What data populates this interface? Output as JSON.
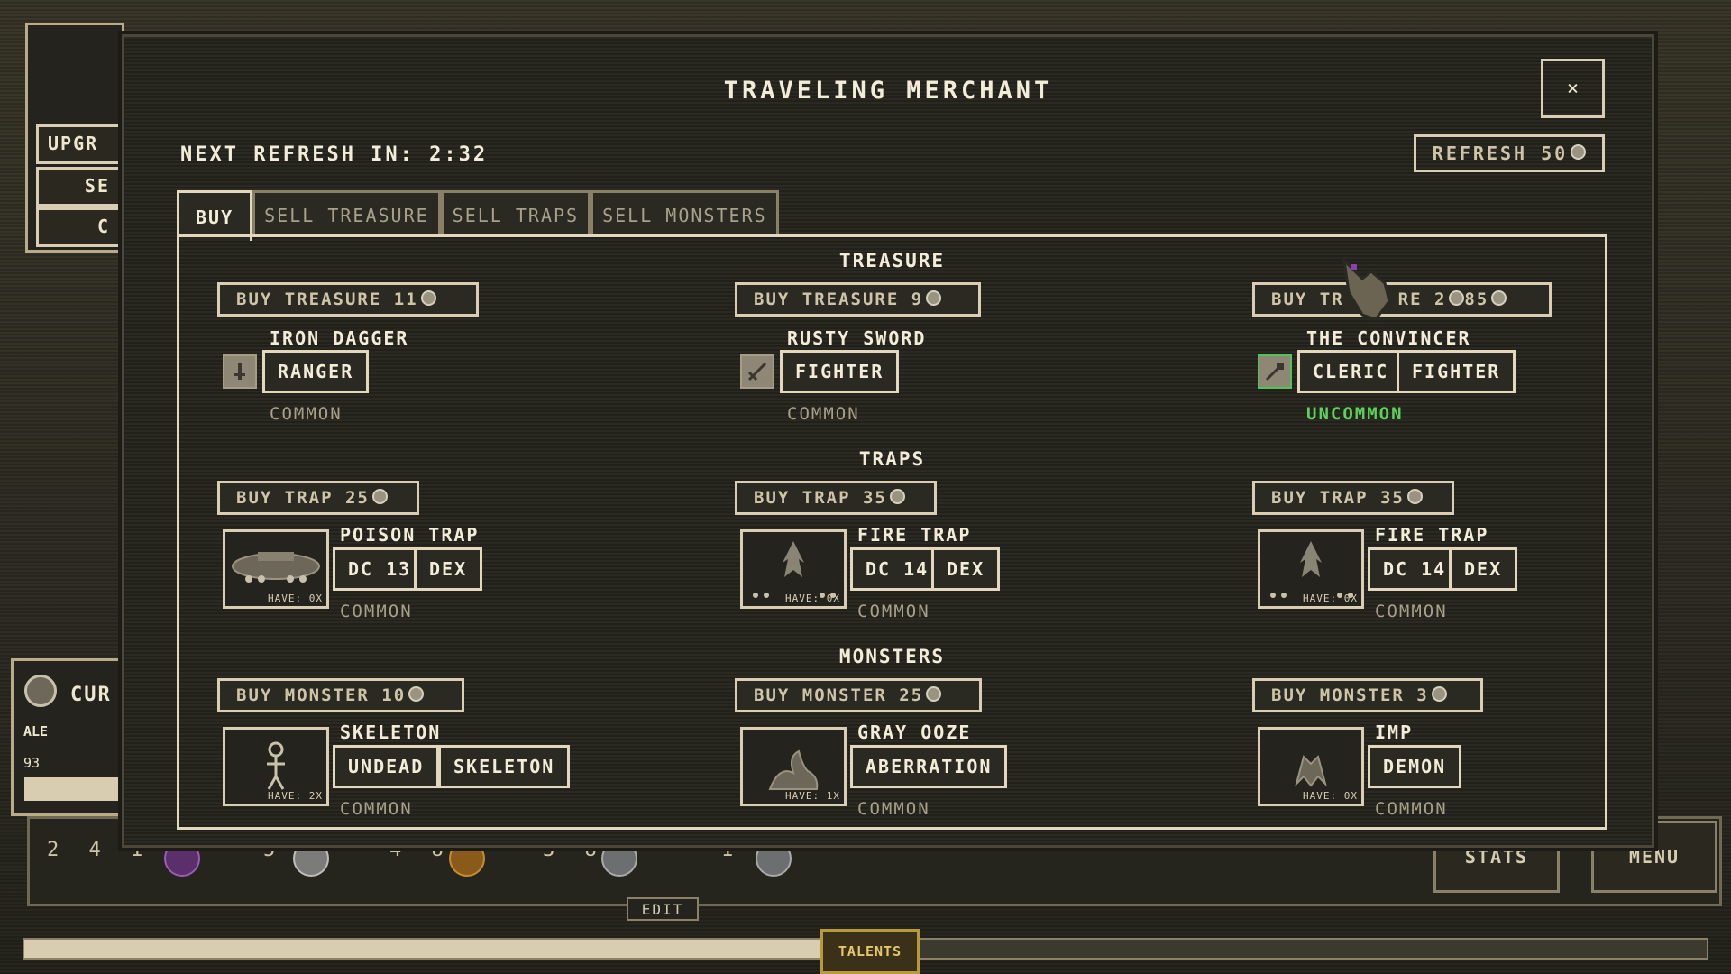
{
  "background": {
    "side_buttons": [
      "UPGR",
      "SE",
      "C"
    ],
    "currency_label": "CUR",
    "ale_label": "ALE",
    "ale_value": "93",
    "hud_slots": [
      "2 4 1 4",
      "5",
      "4 8",
      "3 8",
      "1"
    ],
    "stats_label": "STATS",
    "menu_label": "MENU",
    "edit_label": "EDIT",
    "talents_label": "TALENTS",
    "xp_progress": 0.49
  },
  "modal": {
    "title": "TRAVELING MERCHANT",
    "close_icon": "×",
    "refresh_timer_label": "NEXT REFRESH IN: 2:32",
    "refresh_button": "REFRESH 50",
    "tabs": [
      {
        "label": "BUY",
        "active": true
      },
      {
        "label": "SELL TREASURE",
        "active": false
      },
      {
        "label": "SELL TRAPS",
        "active": false
      },
      {
        "label": "SELL MONSTERS",
        "active": false
      }
    ],
    "sections": {
      "treasure": "TREASURE",
      "traps": "TRAPS",
      "monsters": "MONSTERS"
    },
    "treasure": [
      {
        "buy": "BUY TREASURE 11",
        "name": "IRON DAGGER",
        "tags": [
          "RANGER"
        ],
        "rarity": "COMMON",
        "icon": "dagger-icon"
      },
      {
        "buy": "BUY TREASURE 9",
        "name": "RUSTY SWORD",
        "tags": [
          "FIGHTER"
        ],
        "rarity": "COMMON",
        "icon": "sword-icon"
      },
      {
        "buy_left": "BUY TR",
        "buy_right": "RE 2",
        "buy_extra": "85",
        "name": "THE CONVINCER",
        "tags": [
          "CLERIC",
          "FIGHTER"
        ],
        "rarity": "UNCOMMON",
        "icon": "mace-icon"
      }
    ],
    "traps": [
      {
        "buy": "BUY TRAP 25",
        "name": "POISON TRAP",
        "tags": [
          "DC 13",
          "DEX"
        ],
        "rarity": "COMMON",
        "have": "HAVE: 0X"
      },
      {
        "buy": "BUY TRAP 35",
        "name": "FIRE TRAP",
        "tags": [
          "DC 14",
          "DEX"
        ],
        "rarity": "COMMON",
        "have": "HAVE: 0X"
      },
      {
        "buy": "BUY TRAP 35",
        "name": "FIRE TRAP",
        "tags": [
          "DC 14",
          "DEX"
        ],
        "rarity": "COMMON",
        "have": "HAVE: 0X"
      }
    ],
    "monsters": [
      {
        "buy": "BUY MONSTER 10",
        "name": "SKELETON",
        "tags": [
          "UNDEAD",
          "SKELETON"
        ],
        "rarity": "COMMON",
        "have": "HAVE: 2X"
      },
      {
        "buy": "BUY MONSTER 25",
        "name": "GRAY OOZE",
        "tags": [
          "ABERRATION"
        ],
        "rarity": "COMMON",
        "have": "HAVE: 1X"
      },
      {
        "buy": "BUY MONSTER 3",
        "name": "IMP",
        "tags": [
          "DEMON"
        ],
        "rarity": "COMMON",
        "have": "HAVE: 0X"
      }
    ]
  },
  "colors": {
    "accent": "#e3d8bd",
    "uncommon": "#5bd35b",
    "panel": "#2a2922"
  }
}
